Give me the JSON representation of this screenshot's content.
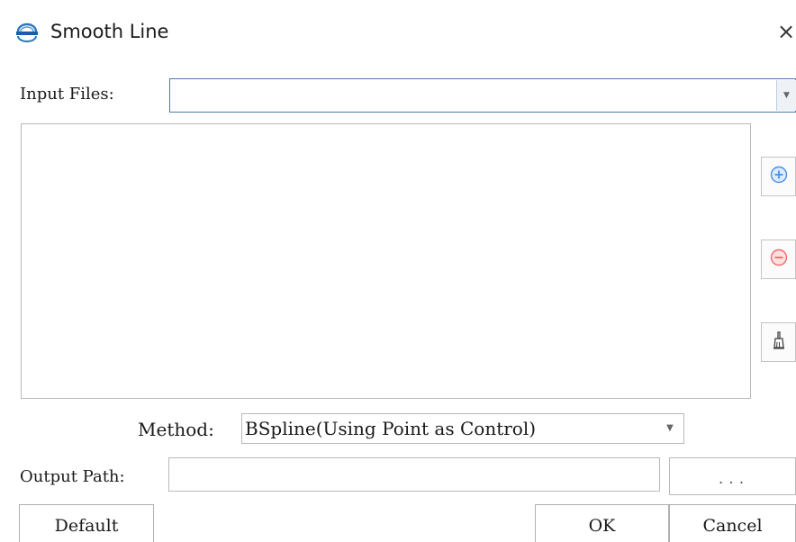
{
  "window": {
    "title": "Smooth Line",
    "close_symbol": "×",
    "app_icon": "lidar-logo-icon"
  },
  "input_files": {
    "label": "Input Files:",
    "value": "",
    "dropdown_icon": "chevron-down-icon"
  },
  "file_list": {
    "items": []
  },
  "side_buttons": {
    "add_icon": "plus-circle-icon",
    "remove_icon": "minus-circle-icon",
    "clear_icon": "brush-icon",
    "colors": {
      "add": "#4a8fe7",
      "remove": "#ee6b6b",
      "clear": "#555555"
    }
  },
  "method": {
    "label": "Method:",
    "selected": "BSpline(Using Point as Control)",
    "dropdown_icon": "chevron-down-icon"
  },
  "output_path": {
    "label": "Output Path:",
    "value": "",
    "browse_label": "..."
  },
  "buttons": {
    "default_label": "Default",
    "ok_label": "OK",
    "cancel_label": "Cancel"
  }
}
